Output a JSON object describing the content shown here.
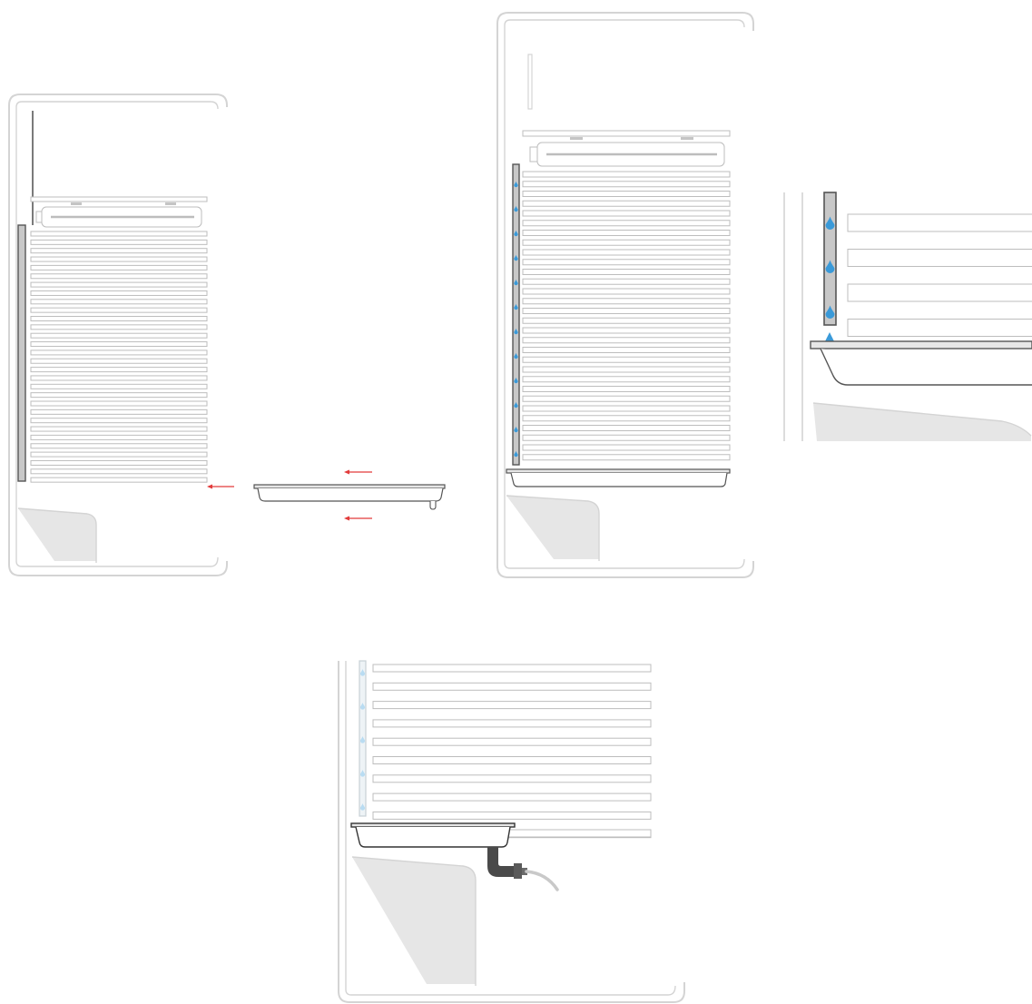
{
  "colors": {
    "background": "#ffffff",
    "outline": "#d4d4d4",
    "rack": "#bdbdbd",
    "fin_fill": "#ffffff",
    "pipe_fill": "#c8c8c8",
    "pipe_dark": "#9a9a9a",
    "water": "#3a9ad9",
    "water_faint": "#b9dcf2",
    "arrow": "#e23b3b",
    "tray": "#555555",
    "elbow": "#4a4a4a",
    "hose": "#c9c9c9",
    "floor": "#e6e6e6"
  },
  "icons": {
    "arrow": "arrow-left-icon",
    "droplet": "water-drop-icon",
    "drain": "drain-elbow-icon"
  },
  "panels": [
    {
      "id": "panel-1",
      "shows": "drip-tray-inserted-under-evaporator-fins",
      "fin_count": 30,
      "arrows": 3,
      "water_drops": 0
    },
    {
      "id": "panel-2",
      "shows": "condensation-running-down-into-tray",
      "fin_count": 30,
      "arrows": 0,
      "water_drops": 12
    },
    {
      "id": "panel-3",
      "shows": "close-up-of-drops-entering-tray",
      "fin_count": 4,
      "arrows": 0,
      "water_drops": 4
    },
    {
      "id": "panel-4",
      "shows": "tray-with-drain-elbow-and-hose",
      "fin_count": 10,
      "arrows": 0,
      "water_drops": 5
    }
  ]
}
